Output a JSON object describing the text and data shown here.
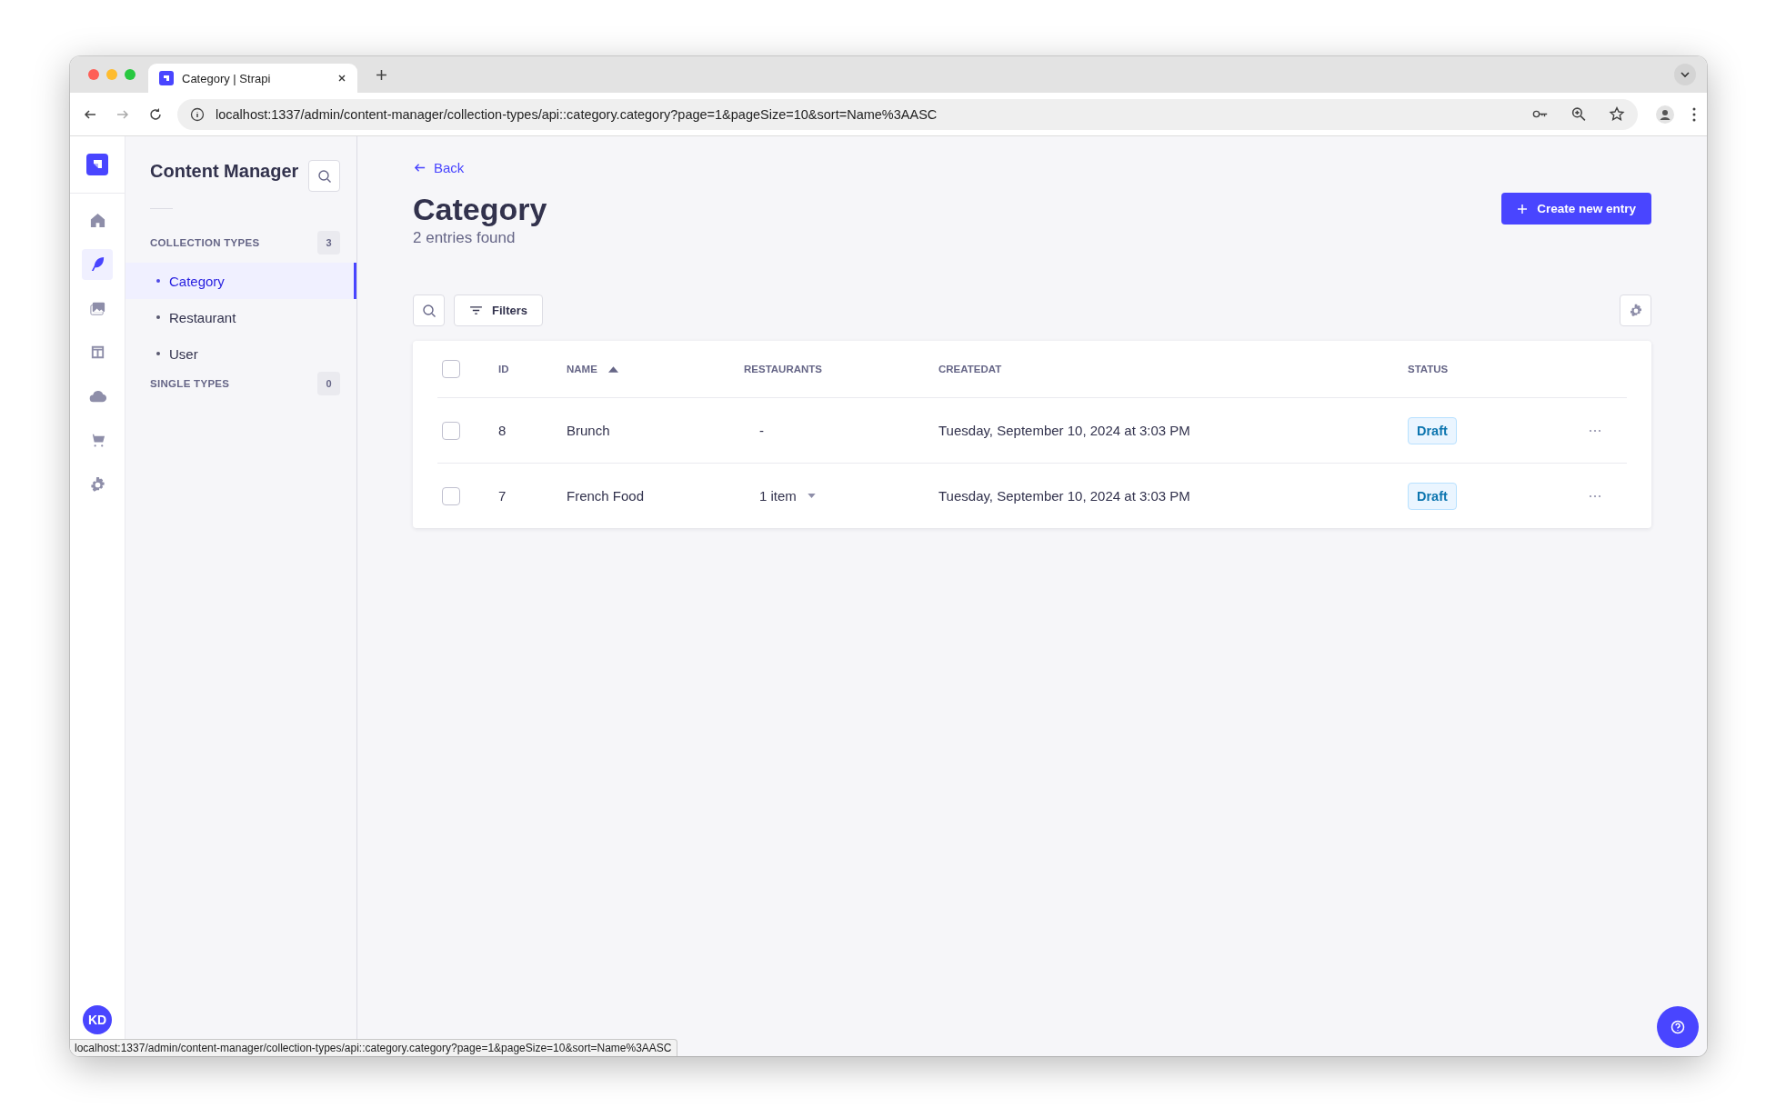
{
  "browser": {
    "tab_title": "Category | Strapi",
    "url": "localhost:1337/admin/content-manager/collection-types/api::category.category?page=1&pageSize=10&sort=Name%3AASC",
    "status_url": "localhost:1337/admin/content-manager/collection-types/api::category.category?page=1&pageSize=10&sort=Name%3AASC"
  },
  "rail": {
    "items": [
      {
        "selected": false
      },
      {
        "selected": true
      },
      {
        "selected": false
      },
      {
        "selected": false
      },
      {
        "selected": false
      },
      {
        "selected": false
      },
      {
        "selected": false
      }
    ],
    "avatar": "KD"
  },
  "sidebar": {
    "title": "Content Manager",
    "sections": [
      {
        "label": "COLLECTION TYPES",
        "count": "3",
        "items": [
          {
            "label": "Category",
            "selected": true
          },
          {
            "label": "Restaurant",
            "selected": false
          },
          {
            "label": "User",
            "selected": false
          }
        ]
      },
      {
        "label": "SINGLE TYPES",
        "count": "0"
      }
    ]
  },
  "page": {
    "back": "Back",
    "title": "Category",
    "subtitle": "2 entries found",
    "create_button": "Create new entry",
    "filters_button": "Filters"
  },
  "table": {
    "header_checked": false,
    "columns": [
      {
        "label": "ID"
      },
      {
        "label": "NAME",
        "sorted": true
      },
      {
        "label": "RESTAURANTS"
      },
      {
        "label": "CREATEDAT"
      },
      {
        "label": "STATUS"
      }
    ],
    "rows": [
      {
        "checked": false,
        "id": "8",
        "name": "Brunch",
        "restaurants": "-",
        "restaurants_dropdown": false,
        "createdat": "Tuesday, September 10, 2024 at 3:03 PM",
        "status": "Draft"
      },
      {
        "checked": false,
        "id": "7",
        "name": "French Food",
        "restaurants": "1 item",
        "restaurants_dropdown": true,
        "createdat": "Tuesday, September 10, 2024 at 3:03 PM",
        "status": "Draft"
      }
    ]
  }
}
